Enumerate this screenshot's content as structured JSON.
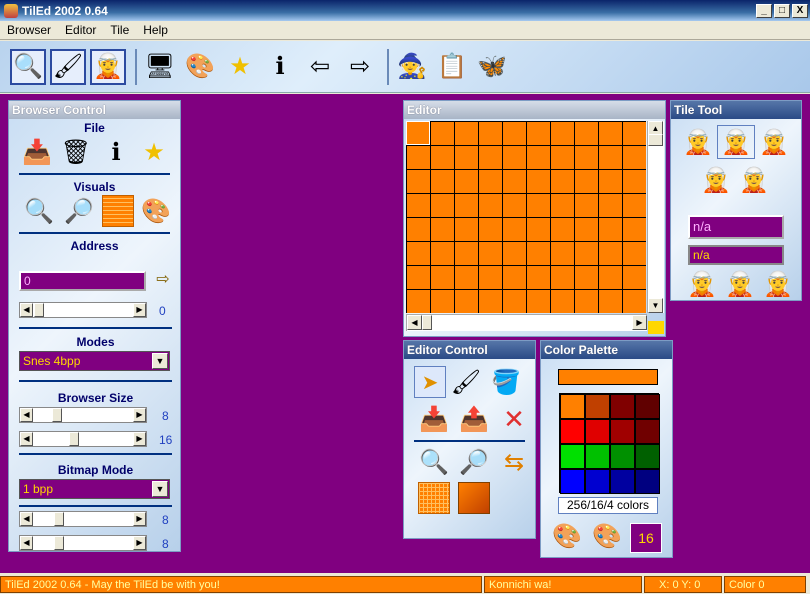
{
  "window": {
    "title": "TilEd 2002 0.64",
    "buttons": [
      "_",
      "□",
      "X"
    ]
  },
  "menu": [
    "Browser",
    "Editor",
    "Tile",
    "Help"
  ],
  "toolbar": {
    "icons": [
      "browser-icon",
      "palette-tool-icon",
      "character-icon",
      "monitor-icon",
      "paint-icon",
      "star-icon",
      "info-icon",
      "import-icon",
      "export-icon",
      "character2-icon",
      "checklist-icon",
      "butterfly-icon"
    ]
  },
  "browser_control": {
    "title": "Browser Control",
    "file_label": "File",
    "visuals_label": "Visuals",
    "address_label": "Address",
    "address_value": "0",
    "address_slider_value": "0",
    "modes_label": "Modes",
    "mode_selected": "Snes 4bpp",
    "browser_size_label": "Browser Size",
    "size_w": "8",
    "size_h": "16",
    "bitmap_mode_label": "Bitmap Mode",
    "bitmap_selected": "1 bpp",
    "bitmap_a": "8",
    "bitmap_b": "8"
  },
  "editor": {
    "title": "Editor",
    "cell_color": "#ff8000"
  },
  "tile_tool": {
    "title": "Tile Tool",
    "field1": "n/a",
    "field2": "n/a"
  },
  "editor_control": {
    "title": "Editor Control"
  },
  "color_palette": {
    "title": "Color Palette",
    "current_color": "#ff8000",
    "colors": [
      "#ff8000",
      "#c04000",
      "#800000",
      "#600000",
      "#ff0000",
      "#e00000",
      "#a00000",
      "#700000",
      "#00e000",
      "#00c000",
      "#009000",
      "#006000",
      "#0000ff",
      "#0000d0",
      "#0000a0",
      "#000080"
    ],
    "modes": "256/16/4 colors",
    "count": "16"
  },
  "status": {
    "message": "TilEd 2002 0.64 - May the TilEd be with you!",
    "greeting": "Konnichi wa!",
    "coords": "X: 0   Y: 0",
    "color": "Color 0"
  }
}
